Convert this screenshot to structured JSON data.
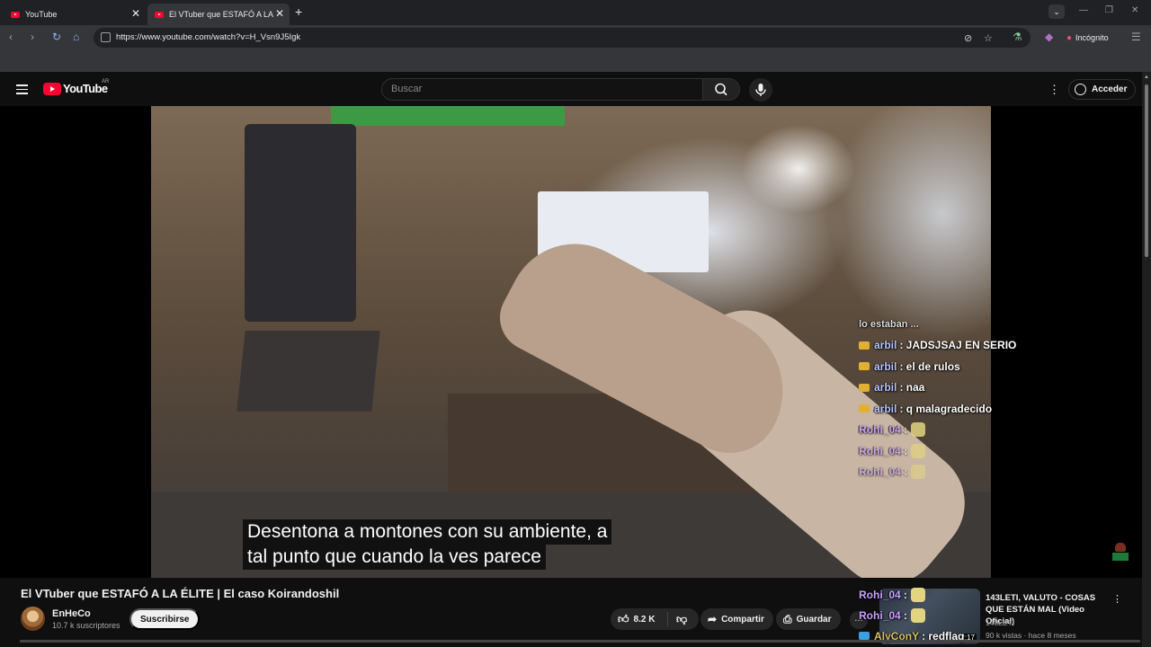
{
  "browser": {
    "tabs": [
      {
        "title": "YouTube",
        "close": "✕"
      },
      {
        "title": "El VTuber que ESTAFÓ A LA",
        "close": "✕"
      }
    ],
    "new_tab": "+",
    "url": "https://www.youtube.com/watch?v=H_Vsn9J5Igk",
    "incognito_label": "Incógnito"
  },
  "header": {
    "logo_text": "YouTube",
    "country_code": "AR",
    "search_placeholder": "Buscar",
    "signin_label": "Acceder"
  },
  "player": {
    "chat": [
      {
        "user": "",
        "text": "lo estaban ... ",
        "partial": true
      },
      {
        "user": "arbil",
        "text": ": JADSJSAJ EN SERIO",
        "badge": true
      },
      {
        "user": "arbil",
        "text": ": el de rulos",
        "badge": true
      },
      {
        "user": "arbil",
        "text": ": naa",
        "badge": true
      },
      {
        "user": "arbil",
        "text": ": q malagradecido",
        "badge": true
      },
      {
        "user": "Rohi_04",
        "text": ":",
        "emote": true
      },
      {
        "user": "Rohi_04",
        "text": ":",
        "emote": true
      },
      {
        "user": "Rohi_04",
        "text": ":",
        "emote": true
      }
    ],
    "subtitle_line1": "Desentona a montones con su ambiente, a",
    "subtitle_line2": "tal punto que cuando la ves parece"
  },
  "video": {
    "title": "El VTuber que ESTAFÓ A LA ÉLITE | El caso Koirandoshil",
    "channel": "EnHeCo",
    "subscribers": "10.7 k suscriptores",
    "subscribe_label": "Suscribirse",
    "likes": "8.2 K",
    "share_label": "Compartir",
    "save_label": "Guardar",
    "more_label": "…"
  },
  "overlay_chat": [
    {
      "user": "Rohi_04",
      "text": ":"
    },
    {
      "user": "Rohi_04",
      "text": ":"
    },
    {
      "user": "AlyConY",
      "text": ": redflag"
    }
  ],
  "recommendation": {
    "title": "143LETI, VALUTO  - COSAS QUE ESTÁN MAL (Video Oficial)",
    "channel": "143LETI",
    "meta": "90 k vistas · hace 8 meses",
    "duration": "2:17"
  },
  "colors": {
    "yt_red": "#ff0033",
    "background": "#0f0f0f",
    "chat_user": "#b9c4ff"
  }
}
